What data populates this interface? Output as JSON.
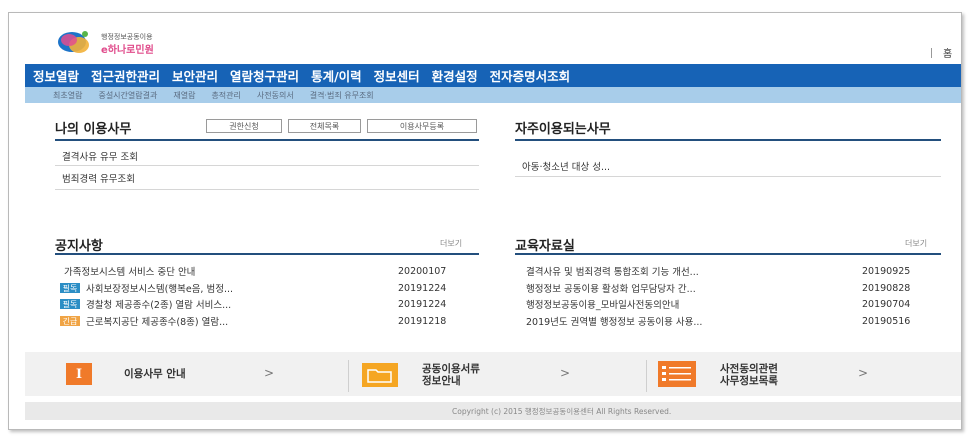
{
  "header": {
    "logo_sub": "행정정보공동이용",
    "logo_main": "e하나로민원",
    "home": "홈"
  },
  "gnb": [
    "정보열람",
    "접근권한관리",
    "보안관리",
    "열람청구관리",
    "통계/이력",
    "정보센터",
    "환경설정",
    "전자증명서조회"
  ],
  "sub_nav": [
    "최초열람",
    "중설시간열람결과",
    "재열람",
    "총적관리",
    "사전동의서",
    "결격·범죄 유무조회"
  ],
  "my_work": {
    "title": "나의 이용사무",
    "buttons": [
      "권한신청",
      "전체목록",
      "이용사무등록"
    ],
    "items": [
      "결격사유 유무 조회",
      "범죄경력 유무조회"
    ]
  },
  "frequent": {
    "title": "자주이용되는사무",
    "items": [
      "아동·청소년 대상 성..."
    ]
  },
  "notices": {
    "title": "공지사항",
    "more": "더보기",
    "rows": [
      {
        "badge": "",
        "title": "가족정보시스템 서비스 중단 안내",
        "date": "20200107"
      },
      {
        "badge": "필독",
        "badge_color": "#2c8ec5",
        "title": "사회보장정보시스템(행복e음, 범정...",
        "date": "20191224"
      },
      {
        "badge": "필독",
        "badge_color": "#2c8ec5",
        "title": "경찰청 제공종수(2종) 열람 서비스...",
        "date": "20191224"
      },
      {
        "badge": "긴급",
        "badge_color": "#f0a445",
        "title": "근로복지공단 제공종수(8종) 열람...",
        "date": "20191218"
      }
    ]
  },
  "education": {
    "title": "교육자료실",
    "more": "더보기",
    "rows": [
      {
        "title": "결격사유 및 범죄경력 통합조회 기능 개선...",
        "date": "20190925"
      },
      {
        "title": "행정정보 공동이용 활성화 업무담당자 간...",
        "date": "20190828"
      },
      {
        "title": "행정정보공동이용_모바일사전동의안내",
        "date": "20190704"
      },
      {
        "title": "2019년도 권역별 행정정보 공동이용 사용...",
        "date": "20190516"
      }
    ]
  },
  "bottom_links": [
    {
      "label": "이용사무 안내",
      "arrow": ">"
    },
    {
      "label_line1": "공동이용서류",
      "label_line2": "정보안내",
      "arrow": ">"
    },
    {
      "label_line1": "사전동의관련",
      "label_line2": "사무정보목록",
      "arrow": ">"
    }
  ],
  "bottom_icon_glyph": "I",
  "colors": {
    "gnb": "#1763b6",
    "sub_nav": "#a8cdea",
    "rule": "#234f7d",
    "icon_orange": "#f07a2a",
    "icon_yellow": "#f5a623"
  },
  "footer": {
    "copyright": "Copyright (c) 2015 행정정보공동이용센터 All Rights Reserved."
  }
}
